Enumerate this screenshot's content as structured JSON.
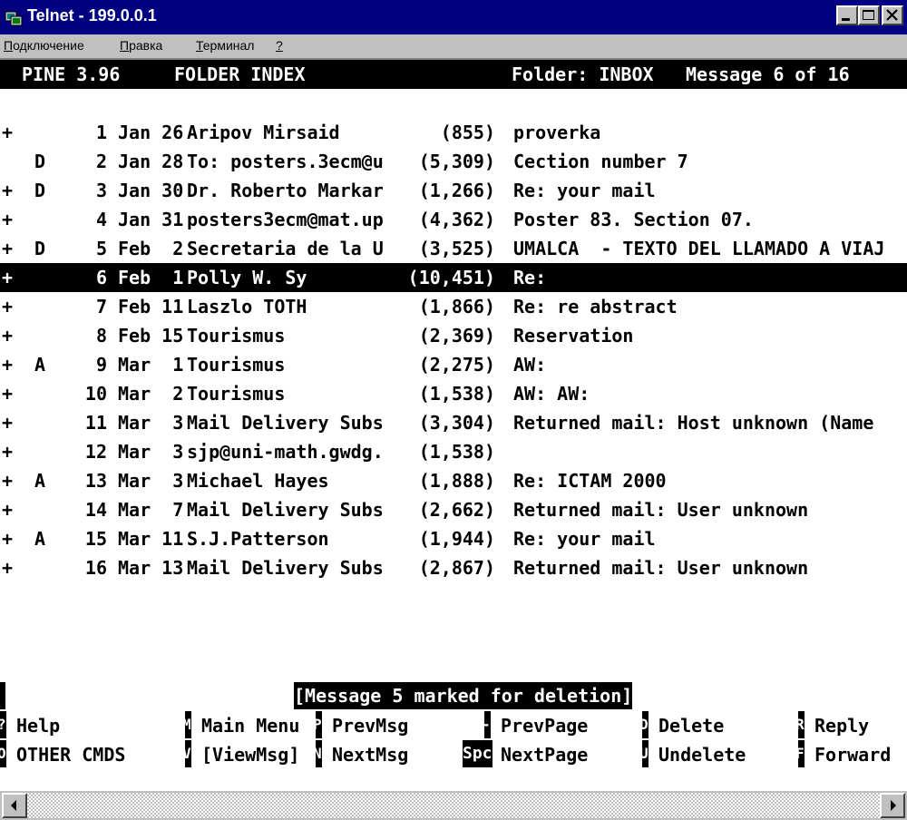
{
  "window": {
    "title": "Telnet - 199.0.0.1"
  },
  "menu": [
    {
      "label": "Подключение",
      "underline": "П",
      "rest": "одключение"
    },
    {
      "label": "Правка",
      "underline": "П",
      "rest": "равка"
    },
    {
      "label": "Терминал",
      "underline": "Т",
      "rest": "ерминал"
    },
    {
      "label": "?",
      "underline": "?",
      "rest": ""
    }
  ],
  "header": {
    "app": "PINE 3.96",
    "screen": "FOLDER INDEX",
    "folder": "Folder: INBOX",
    "position": "Message 6 of 16"
  },
  "messages": [
    {
      "flag": "+",
      "status": "",
      "num": "1",
      "date": "Jan 26",
      "from": "Aripov Mirsaid",
      "size": "(855)",
      "subject": "proverka"
    },
    {
      "flag": "",
      "status": "D",
      "num": "2",
      "date": "Jan 28",
      "from": "To: posters.3ecm@u",
      "size": "(5,309)",
      "subject": "Cection number 7"
    },
    {
      "flag": "+",
      "status": "D",
      "num": "3",
      "date": "Jan 30",
      "from": "Dr. Roberto Markar",
      "size": "(1,266)",
      "subject": "Re: your mail"
    },
    {
      "flag": "+",
      "status": "",
      "num": "4",
      "date": "Jan 31",
      "from": "posters3ecm@mat.up",
      "size": "(4,362)",
      "subject": "Poster 83. Section 07."
    },
    {
      "flag": "+",
      "status": "D",
      "num": "5",
      "date": "Feb  2",
      "from": "Secretaria de la U",
      "size": "(3,525)",
      "subject": "UMALCA  - TEXTO DEL LLAMADO A VIAJ"
    },
    {
      "flag": "+",
      "status": "",
      "num": "6",
      "date": "Feb  1",
      "from": "Polly W. Sy",
      "size": "(10,451)",
      "subject": "Re:",
      "selected": true
    },
    {
      "flag": "+",
      "status": "",
      "num": "7",
      "date": "Feb 11",
      "from": "Laszlo TOTH",
      "size": "(1,866)",
      "subject": "Re: re abstract"
    },
    {
      "flag": "+",
      "status": "",
      "num": "8",
      "date": "Feb 15",
      "from": "Tourismus",
      "size": "(2,369)",
      "subject": "Reservation"
    },
    {
      "flag": "+",
      "status": "A",
      "num": "9",
      "date": "Mar  1",
      "from": "Tourismus",
      "size": "(2,275)",
      "subject": "AW:"
    },
    {
      "flag": "+",
      "status": "",
      "num": "10",
      "date": "Mar  2",
      "from": "Tourismus",
      "size": "(1,538)",
      "subject": "AW: AW:"
    },
    {
      "flag": "+",
      "status": "",
      "num": "11",
      "date": "Mar  3",
      "from": "Mail Delivery Subs",
      "size": "(3,304)",
      "subject": "Returned mail: Host unknown (Name"
    },
    {
      "flag": "+",
      "status": "",
      "num": "12",
      "date": "Mar  3",
      "from": "sjp@uni-math.gwdg.",
      "size": "(1,538)",
      "subject": ""
    },
    {
      "flag": "+",
      "status": "A",
      "num": "13",
      "date": "Mar  3",
      "from": "Michael Hayes",
      "size": "(1,888)",
      "subject": "Re: ICTAM 2000"
    },
    {
      "flag": "+",
      "status": "",
      "num": "14",
      "date": "Mar  7",
      "from": "Mail Delivery Subs",
      "size": "(2,662)",
      "subject": "Returned mail: User unknown"
    },
    {
      "flag": "+",
      "status": "A",
      "num": "15",
      "date": "Mar 11",
      "from": "S.J.Patterson",
      "size": "(1,944)",
      "subject": "Re: your mail"
    },
    {
      "flag": "+",
      "status": "",
      "num": "16",
      "date": "Mar 13",
      "from": "Mail Delivery Subs",
      "size": "(2,867)",
      "subject": "Returned mail: User unknown"
    }
  ],
  "status_message": "[Message 5 marked for deletion]",
  "commands_row1": [
    {
      "key": "?",
      "label": "Help"
    },
    {
      "key": "M",
      "label": "Main Menu"
    },
    {
      "key": "P",
      "label": "PrevMsg"
    },
    {
      "key": "-",
      "label": "PrevPage"
    },
    {
      "key": "D",
      "label": "Delete"
    },
    {
      "key": "R",
      "label": "Reply"
    }
  ],
  "commands_row2": [
    {
      "key": "O",
      "label": "OTHER CMDS"
    },
    {
      "key": "V",
      "label": "[ViewMsg]"
    },
    {
      "key": "N",
      "label": "NextMsg"
    },
    {
      "key": "Spc",
      "label": "NextPage"
    },
    {
      "key": "U",
      "label": "Undelete"
    },
    {
      "key": "F",
      "label": "Forward"
    }
  ],
  "colors": {
    "titlebar": "#000080",
    "chrome": "#c0c0c0",
    "terminal_bg": "#ffffff",
    "terminal_fg": "#000000"
  },
  "icons": [
    "telnet-app-icon",
    "minimize-icon",
    "maximize-icon",
    "close-icon",
    "scroll-left-icon",
    "scroll-right-icon"
  ]
}
